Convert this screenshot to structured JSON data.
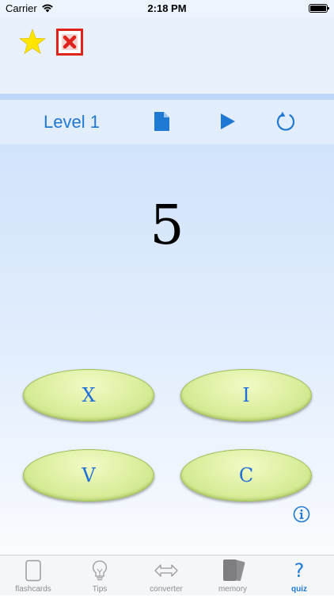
{
  "status_bar": {
    "carrier": "Carrier",
    "time": "2:18 PM"
  },
  "toolbar": {
    "level_label": "Level 1"
  },
  "question": {
    "value": "5"
  },
  "answers": [
    {
      "label": "X"
    },
    {
      "label": "I"
    },
    {
      "label": "V"
    },
    {
      "label": "C"
    }
  ],
  "tabs": [
    {
      "label": "flashcards",
      "icon": "flashcard-icon",
      "active": false
    },
    {
      "label": "Tips",
      "icon": "lightbulb-icon",
      "active": false
    },
    {
      "label": "converter",
      "icon": "arrows-icon",
      "active": false
    },
    {
      "label": "memory",
      "icon": "cards-icon",
      "active": false
    },
    {
      "label": "quiz",
      "icon": "question-mark-icon",
      "active": true
    }
  ],
  "colors": {
    "accent": "#1f78d1",
    "answer_button": "#dff0a4",
    "star": "#ffe600",
    "close": "#e0241b",
    "tab_inactive": "#8e8e93"
  }
}
